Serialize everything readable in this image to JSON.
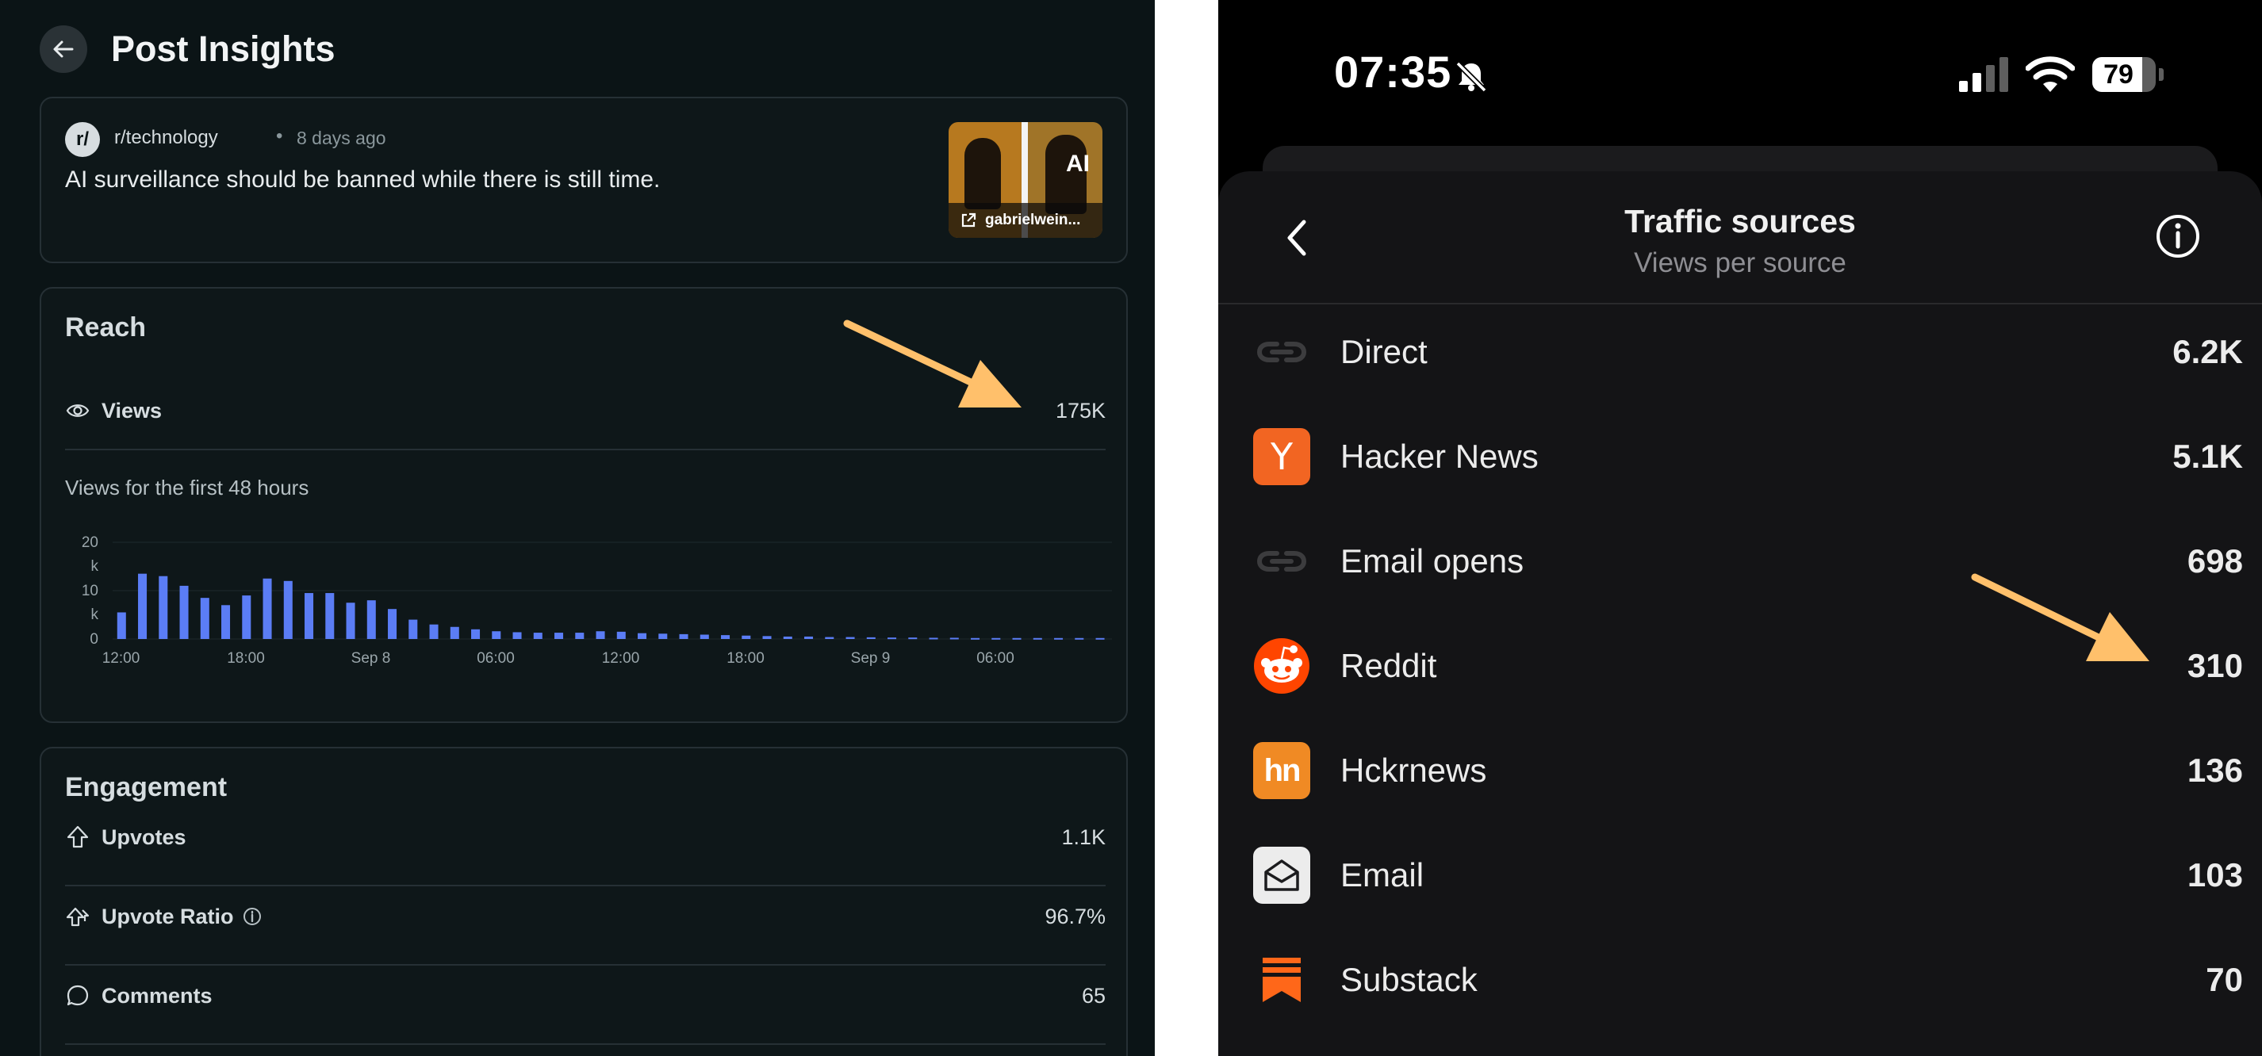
{
  "colors": {
    "left_bg": "#0b1416",
    "card_border": "#263035",
    "bar_blue": "#5b7df5",
    "arrow_orange": "#ffc06b",
    "right_bg": "#000000",
    "sheet_bg": "#141416",
    "hn_orange": "#f26522",
    "reddit_orange": "#ff4500",
    "substack_orange": "#ff6719"
  },
  "insights": {
    "back_icon": "arrow-left-icon",
    "title": "Post Insights",
    "post": {
      "subreddit_avatar": "r/",
      "subreddit": "r/technology",
      "separator": "•",
      "age": "8 days ago",
      "title": "AI surveillance should be banned while there is still time.",
      "thumbnail_overlay_text": "AI",
      "thumbnail_link_icon": "external-link-icon",
      "thumbnail_caption": "gabrielwein..."
    },
    "reach": {
      "title": "Reach",
      "views_icon": "eye-icon",
      "views_label": "Views",
      "views_value": "175K",
      "chart_caption": "Views for the first 48 hours"
    },
    "engagement": {
      "title": "Engagement",
      "rows": [
        {
          "icon": "upvote-arrow-icon",
          "label": "Upvotes",
          "value": "1.1K"
        },
        {
          "icon": "upvote-ratio-icon",
          "label": "Upvote Ratio",
          "value": "96.7%",
          "info_icon": "info-icon"
        },
        {
          "icon": "comment-bubble-icon",
          "label": "Comments",
          "value": "65"
        }
      ]
    }
  },
  "chart_data": {
    "type": "bar",
    "title": "Views for the first 48 hours",
    "x_tick_labels": [
      "12:00",
      "18:00",
      "Sep 8",
      "06:00",
      "12:00",
      "18:00",
      "Sep 9",
      "06:00"
    ],
    "y_tick_labels": [
      "20 k",
      "10 k",
      "0"
    ],
    "ylim": [
      0,
      20000
    ],
    "grid": true,
    "values": [
      5500,
      13500,
      13000,
      11000,
      8500,
      7000,
      9000,
      12500,
      12000,
      9500,
      9500,
      7500,
      8000,
      6200,
      4000,
      3000,
      2500,
      2000,
      1600,
      1400,
      1300,
      1300,
      1300,
      1600,
      1500,
      1200,
      1100,
      1000,
      900,
      800,
      700,
      600,
      500,
      500,
      400,
      400,
      350,
      300,
      300,
      250,
      250,
      200,
      200,
      200,
      200,
      200,
      200,
      200
    ]
  },
  "phone": {
    "time": "07:35",
    "silent_icon": "bell-slash-icon",
    "signal_icon": "cellular-signal-icon",
    "wifi_icon": "wifi-icon",
    "battery_level": "79",
    "battery_fraction": 0.79,
    "sheet": {
      "back_icon": "chevron-left-icon",
      "title": "Traffic sources",
      "subtitle": "Views per source",
      "info_icon": "info-circle-icon"
    },
    "sources": [
      {
        "icon": "link-icon",
        "glyph": "",
        "label": "Direct",
        "value": "6.2K"
      },
      {
        "icon": "hacker-news-icon",
        "glyph": "Y",
        "label": "Hacker News",
        "value": "5.1K"
      },
      {
        "icon": "link-icon",
        "glyph": "",
        "label": "Email opens",
        "value": "698"
      },
      {
        "icon": "reddit-icon",
        "glyph": "",
        "label": "Reddit",
        "value": "310"
      },
      {
        "icon": "hckrnews-icon",
        "glyph": "hn",
        "label": "Hckrnews",
        "value": "136"
      },
      {
        "icon": "email-open-icon",
        "glyph": "",
        "label": "Email",
        "value": "103"
      },
      {
        "icon": "substack-icon",
        "glyph": "",
        "label": "Substack",
        "value": "70"
      }
    ]
  },
  "annotations": {
    "left_arrow_icon": "annotation-arrow-icon",
    "right_arrow_icon": "annotation-arrow-icon"
  }
}
